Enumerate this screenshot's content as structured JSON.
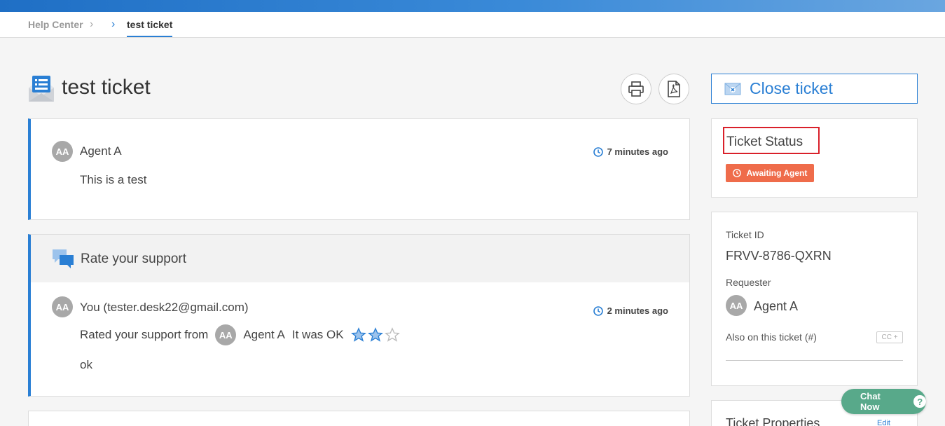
{
  "breadcrumb": {
    "home": "Help Center",
    "current": "test ticket"
  },
  "ticket": {
    "title": "test ticket"
  },
  "messages": [
    {
      "avatar": "AA",
      "author": "Agent A",
      "time": "7 minutes ago",
      "body": "This is a test"
    }
  ],
  "rating": {
    "header": "Rate your support",
    "avatar": "AA",
    "author": "You (tester.desk22@gmail.com)",
    "time": "2 minutes ago",
    "rated_prefix": "Rated your support from",
    "agent_avatar": "AA",
    "agent_name": "Agent A",
    "rating_text": "It was OK",
    "stars_filled": 2,
    "stars_total": 3,
    "comment": "ok"
  },
  "sidebar": {
    "close_label": "Close ticket",
    "status_title": "Ticket Status",
    "status_badge": "Awaiting Agent",
    "ticket_id_label": "Ticket ID",
    "ticket_id": "FRVV-8786-QXRN",
    "requester_label": "Requester",
    "requester_avatar": "AA",
    "requester_name": "Agent A",
    "also_label": "Also on this ticket (#)",
    "cc_label": "CC +",
    "props_title": "Ticket Properties",
    "props_edit": "Edit"
  },
  "chat": {
    "label": "Chat Now",
    "help_glyph": "?"
  },
  "colors": {
    "accent": "#2a7fd4",
    "status_badge": "#ef6c4b",
    "chat": "#58a98a",
    "highlight_border": "#d9202a"
  }
}
